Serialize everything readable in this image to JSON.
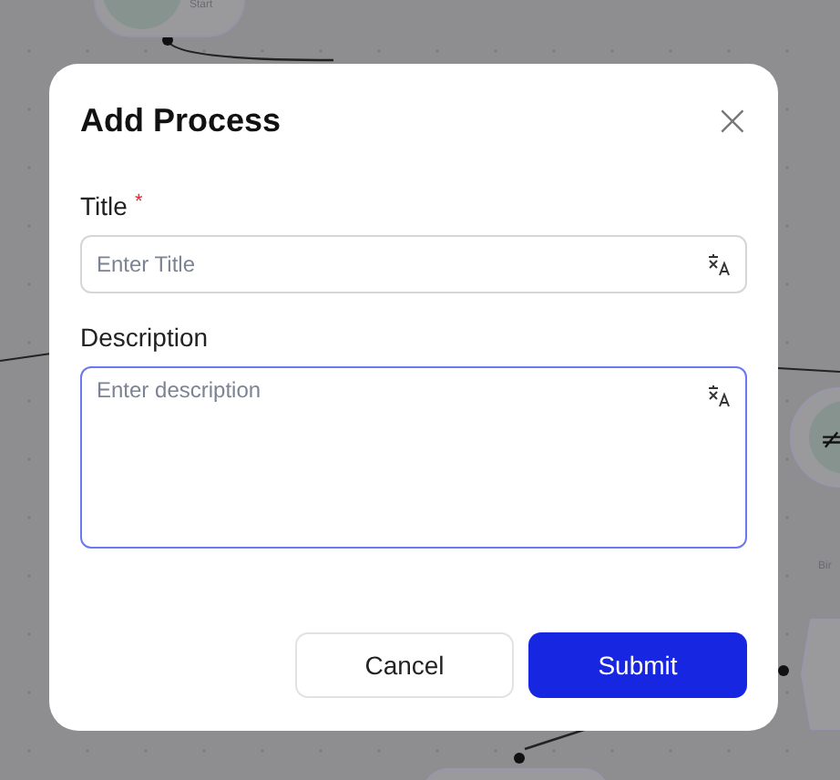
{
  "canvas": {
    "nodes": [
      {
        "kind": "start",
        "label": "Start"
      },
      {
        "kind": "compare",
        "symbol": "≠",
        "label": "Bir"
      }
    ]
  },
  "dialog": {
    "title": "Add Process",
    "close_symbol": "×",
    "fields": [
      {
        "kind": "input",
        "label": "Title",
        "required_mark": "*",
        "placeholder": "Enter Title",
        "focused": false
      },
      {
        "kind": "textarea",
        "label": "Description",
        "placeholder": "Enter description",
        "focused": true
      }
    ],
    "buttons": [
      {
        "label": "Cancel",
        "kind": "secondary"
      },
      {
        "label": "Submit",
        "kind": "primary"
      }
    ]
  }
}
